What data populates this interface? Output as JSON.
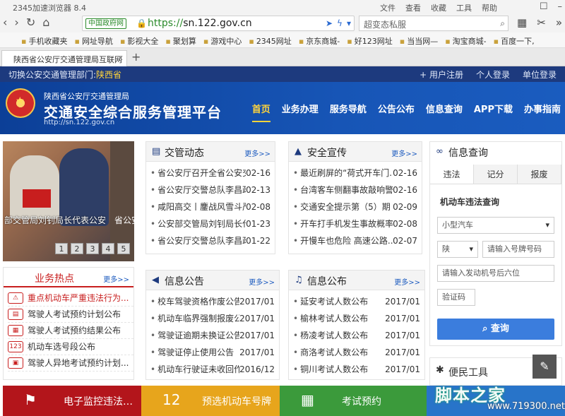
{
  "browser": {
    "title": "2345加速浏览器 8.4",
    "menu": [
      "文件",
      "查看",
      "收藏",
      "工具",
      "帮助"
    ],
    "gov_badge": "中国政府网",
    "url_prefix": "https://",
    "url_host": "sn.122.gov.cn",
    "search_placeholder": "超变态私服",
    "bookmarks": [
      "手机收藏夹",
      "网址导航",
      "影视大全",
      "聚划算",
      "游戏中心",
      "2345网址",
      "京东商城-",
      "好123网址",
      "当当网—",
      "淘宝商城-",
      "百度一下,"
    ],
    "tab_title": "陕西省公安厅交通管理局互联网"
  },
  "site": {
    "province_label": "切换公安交通管理部门:",
    "province": "陕西省",
    "user_links": [
      "+ 用户注册",
      "个人登录",
      "单位登录"
    ],
    "sub_title": "陕西省公安厅交通管理局",
    "main_title": "交通安全综合服务管理平台",
    "site_url": "http://sn.122.gov.cn",
    "nav": [
      "首页",
      "业务办理",
      "服务导航",
      "公告公布",
      "信息查询",
      "APP下载",
      "办事指南"
    ]
  },
  "carousel": {
    "caption": "部交管局刘钊局长代表公安",
    "caption_side": "省公安 县...",
    "pages": [
      "1",
      "2",
      "3",
      "4",
      "5"
    ]
  },
  "hot": {
    "title": "业务热点",
    "more": "更多>>",
    "items": [
      {
        "label": "重点机动车严重违法行为...",
        "icon": "car-violation-icon"
      },
      {
        "label": "驾驶人考试预约计划公布",
        "icon": "calendar-plan-icon"
      },
      {
        "label": "驾驶人考试预约结果公布",
        "icon": "calendar-result-icon"
      },
      {
        "label": "机动车选号段公布",
        "icon": "plate-number-icon"
      },
      {
        "label": "驾驶人异地考试预约计划...",
        "icon": "id-card-icon"
      }
    ]
  },
  "news": {
    "title": "交管动态",
    "more": "更多>>",
    "items": [
      {
        "t": "省公安厅召开全省公安交...",
        "d": "02-16"
      },
      {
        "t": "省公安厅交警总队李昌政...",
        "d": "02-13"
      },
      {
        "t": "咸阳高交丨鏖战风雪斗严...",
        "d": "02-08"
      },
      {
        "t": "公安部交管局刘钊局长代...",
        "d": "01-23"
      },
      {
        "t": "省公安厅交警总队李昌政...",
        "d": "01-22"
      }
    ]
  },
  "safety": {
    "title": "安全宣传",
    "more": "更多>>",
    "items": [
      {
        "t": "最近刷屏的“荷式开车门...",
        "d": "02-16"
      },
      {
        "t": "台湾客车侧翻事故敲响警...",
        "d": "02-16"
      },
      {
        "t": "交通安全提示第（5）期",
        "d": "02-09"
      },
      {
        "t": "开车打手机发生事故概率...",
        "d": "02-08"
      },
      {
        "t": "开慢车也危险 高速公路...",
        "d": "02-07"
      }
    ]
  },
  "notice": {
    "title": "信息公告",
    "more": "更多>>",
    "items": [
      {
        "t": "校车驾驶资格作废公告",
        "d": "2017/01"
      },
      {
        "t": "机动车临界强制报废公告",
        "d": "2017/01"
      },
      {
        "t": "驾驶证逾期未换证公告",
        "d": "2017/01"
      },
      {
        "t": "驾驶证停止使用公告",
        "d": "2017/01"
      },
      {
        "t": "机动车行驶证未收回作...",
        "d": "2016/12"
      }
    ]
  },
  "publish": {
    "title": "信息公布",
    "more": "更多>>",
    "items": [
      {
        "t": "延安考试人数公布",
        "d": "2017/01"
      },
      {
        "t": "榆林考试人数公布",
        "d": "2017/01"
      },
      {
        "t": "杨凌考试人数公布",
        "d": "2017/01"
      },
      {
        "t": "商洛考试人数公布",
        "d": "2017/01"
      },
      {
        "t": "铜川考试人数公布",
        "d": "2017/01"
      }
    ]
  },
  "query": {
    "title": "信息查询",
    "tabs": [
      "违法",
      "记分",
      "报废"
    ],
    "label": "机动车违法查询",
    "vehicle_type": "小型汽车",
    "province_prefix": "陕",
    "plate_placeholder": "请输入号牌号码",
    "engine_placeholder": "请输入发动机号后六位",
    "captcha_placeholder": "验证码",
    "button": "查询"
  },
  "tools": {
    "title": "便民工具"
  },
  "banners": [
    {
      "label": "电子监控违法…",
      "color": "#b3151b"
    },
    {
      "label": "预选机动车号牌",
      "color": "#e7a51c"
    },
    {
      "label": "考试预约",
      "color": "#3b9a3b"
    },
    {
      "label": "",
      "color": "#2874c9"
    }
  ],
  "watermark": {
    "text": "脚本之家",
    "url": "www.719300.net"
  }
}
